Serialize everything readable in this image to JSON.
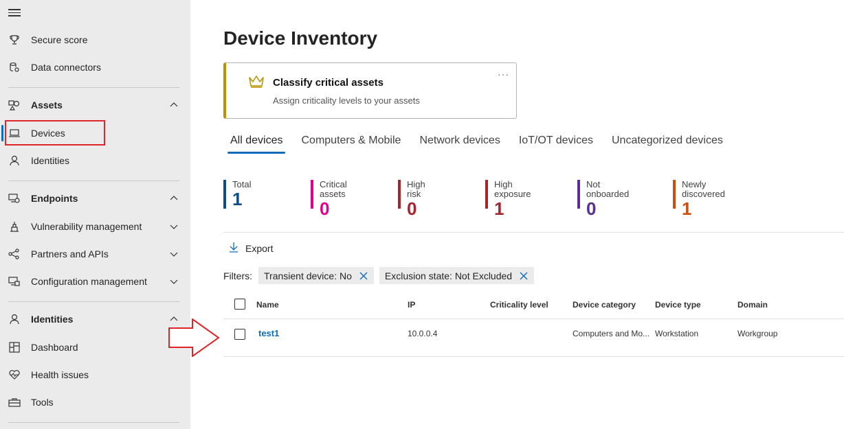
{
  "sidebar": {
    "items": [
      {
        "label": "Secure score",
        "icon": "trophy-icon"
      },
      {
        "label": "Data connectors",
        "icon": "data-connectors-icon"
      },
      {
        "label": "Assets",
        "icon": "assets-icon",
        "group": true
      },
      {
        "label": "Devices",
        "icon": "laptop-icon",
        "active": true
      },
      {
        "label": "Identities",
        "icon": "person-icon"
      },
      {
        "label": "Endpoints",
        "icon": "endpoints-icon",
        "group": true
      },
      {
        "label": "Vulnerability management",
        "icon": "vulnerability-icon"
      },
      {
        "label": "Partners and APIs",
        "icon": "partners-icon"
      },
      {
        "label": "Configuration management",
        "icon": "configuration-icon"
      },
      {
        "label": "Identities",
        "icon": "person-icon",
        "group": true
      },
      {
        "label": "Dashboard",
        "icon": "dashboard-icon"
      },
      {
        "label": "Health issues",
        "icon": "heart-pulse-icon"
      },
      {
        "label": "Tools",
        "icon": "toolbox-icon"
      }
    ]
  },
  "main": {
    "title": "Device Inventory",
    "card": {
      "title": "Classify critical assets",
      "subtitle": "Assign criticality levels to your assets",
      "more": "···"
    },
    "tabs": [
      "All devices",
      "Computers & Mobile",
      "Network devices",
      "IoT/OT devices",
      "Uncategorized devices"
    ],
    "stats": [
      {
        "label": "Total",
        "value": "1",
        "color": "#0f4a8a"
      },
      {
        "label": "Critical assets",
        "value": "0",
        "color": "#e3008c"
      },
      {
        "label": "High risk",
        "value": "0",
        "color": "#a4262c"
      },
      {
        "label": "High exposure",
        "value": "1",
        "color": "#a4262c"
      },
      {
        "label": "Not onboarded",
        "value": "0",
        "color": "#5c2e91"
      },
      {
        "label": "Newly discovered",
        "value": "1",
        "color": "#ca5010"
      }
    ],
    "export_label": "Export",
    "filters_label": "Filters:",
    "filters": [
      "Transient device: No",
      "Exclusion state: Not Excluded"
    ],
    "table": {
      "columns": [
        "Name",
        "IP",
        "Criticality level",
        "Device category",
        "Device type",
        "Domain"
      ],
      "rows": [
        {
          "name": "test1",
          "ip": "10.0.0.4",
          "criticality": "",
          "category": "Computers and Mo...",
          "type": "Workstation",
          "domain": "Workgroup"
        }
      ]
    }
  },
  "colors": {
    "accent": "#0f6cbd",
    "card_accent": "#b89500",
    "annotation_red": "#e0242a"
  }
}
